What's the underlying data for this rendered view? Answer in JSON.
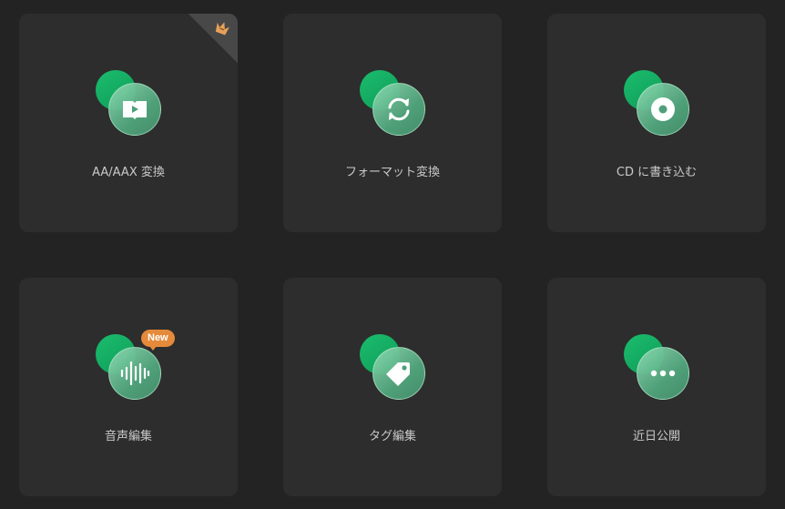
{
  "tools": [
    {
      "label": "AA/AAX 変換",
      "icon": "audiobook-play-icon",
      "premium_badge": "crown-icon"
    },
    {
      "label": "フォーマット変換",
      "icon": "convert-arrows-icon"
    },
    {
      "label": "CD に書き込む",
      "icon": "disc-icon"
    },
    {
      "label": "音声編集",
      "icon": "audio-wave-icon",
      "badge": "New"
    },
    {
      "label": "タグ編集",
      "icon": "tag-icon"
    },
    {
      "label": "近日公開",
      "icon": "more-dots-icon"
    }
  ],
  "colors": {
    "background": "#232323",
    "card": "#2d2d2d",
    "accent_green": "#1bbd6f",
    "badge_orange": "#e58a3b",
    "label_text": "#c9c9c9"
  }
}
